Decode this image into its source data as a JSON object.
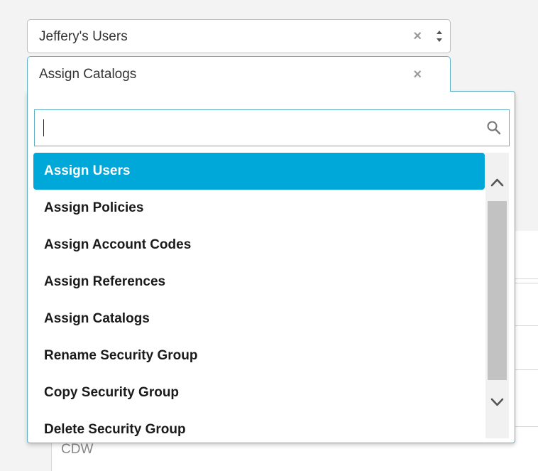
{
  "background": {
    "text": "CDW"
  },
  "select1": {
    "value": "Jeffery's Users",
    "clear_symbol": "×",
    "arrows_icon": "up-down-arrows-icon"
  },
  "select2": {
    "value": "Assign Catalogs",
    "clear_symbol": "×"
  },
  "dropdown": {
    "search": {
      "value": "",
      "icon": "search-icon"
    },
    "options": [
      {
        "label": "Assign Users",
        "highlighted": true
      },
      {
        "label": "Assign Policies"
      },
      {
        "label": "Assign Account Codes"
      },
      {
        "label": "Assign References"
      },
      {
        "label": "Assign Catalogs"
      },
      {
        "label": "Rename Security Group"
      },
      {
        "label": "Copy Security Group"
      },
      {
        "label": "Delete Security Group"
      }
    ]
  },
  "colors": {
    "accent": "#00a8da",
    "focus_border": "#5fb2c6",
    "scrollbar_thumb": "#c2c2c2"
  }
}
